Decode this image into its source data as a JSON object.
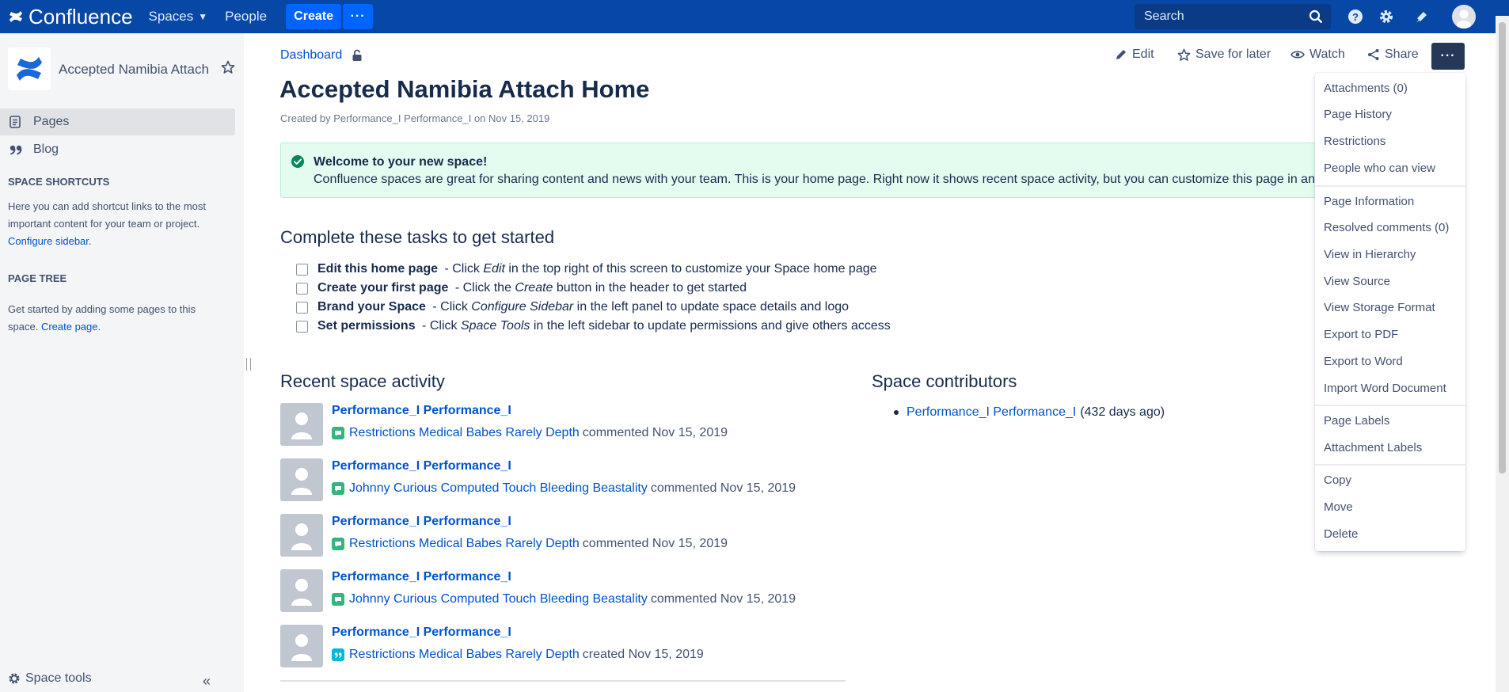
{
  "topbar": {
    "brand": "Confluence",
    "nav": [
      {
        "label": "Spaces"
      },
      {
        "label": "People"
      }
    ],
    "create_label": "Create",
    "search_placeholder": "Search"
  },
  "sidebar": {
    "space_name": "Accepted Namibia Attach",
    "nav": [
      {
        "label": "Pages"
      },
      {
        "label": "Blog"
      }
    ],
    "shortcuts_heading": "SPACE SHORTCUTS",
    "shortcuts_text": "Here you can add shortcut links to the most important content for your team or project.",
    "shortcuts_link": "Configure sidebar",
    "page_tree_heading": "PAGE TREE",
    "page_tree_text": "Get started by adding some pages to this space.",
    "page_tree_link": "Create page",
    "space_tools": "Space tools"
  },
  "breadcrumb": {
    "label": "Dashboard"
  },
  "actions": {
    "edit": "Edit",
    "save_for_later": "Save for later",
    "watch": "Watch",
    "share": "Share"
  },
  "page": {
    "title": "Accepted Namibia Attach Home",
    "byline": "Created by Performance_I Performance_I on Nov 15, 2019"
  },
  "info_panel": {
    "title": "Welcome to your new space!",
    "body": "Confluence spaces are great for sharing content and news with your team. This is your home page. Right now it shows recent space activity, but you can customize this page in any way you like."
  },
  "tasks": {
    "heading": "Complete these tasks to get started",
    "items": [
      {
        "bold": "Edit this home page",
        "pre": " - Click ",
        "em": "Edit",
        "post": " in the top right of this screen to customize your Space home page"
      },
      {
        "bold": "Create your first page",
        "pre": " - Click the ",
        "em": "Create",
        "post": " button in the header to get started"
      },
      {
        "bold": "Brand your Space",
        "pre": " - Click ",
        "em": "Configure Sidebar",
        "post": " in the left panel to update space details and logo"
      },
      {
        "bold": "Set permissions",
        "pre": " - Click ",
        "em": "Space Tools",
        "post": " in the left sidebar to update permissions and give others access"
      }
    ]
  },
  "recent": {
    "heading": "Recent space activity",
    "items": [
      {
        "user": "Performance_I Performance_I",
        "page": "Restrictions Medical Babes Rarely Depth",
        "action": "commented Nov 15, 2019",
        "type": "comment"
      },
      {
        "user": "Performance_I Performance_I",
        "page": "Johnny Curious Computed Touch Bleeding Beastality",
        "action": "commented Nov 15, 2019",
        "type": "comment"
      },
      {
        "user": "Performance_I Performance_I",
        "page": "Restrictions Medical Babes Rarely Depth",
        "action": "commented Nov 15, 2019",
        "type": "comment"
      },
      {
        "user": "Performance_I Performance_I",
        "page": "Johnny Curious Computed Touch Bleeding Beastality",
        "action": "commented Nov 15, 2019",
        "type": "comment"
      },
      {
        "user": "Performance_I Performance_I",
        "page": "Restrictions Medical Babes Rarely Depth",
        "action": "created Nov 15, 2019",
        "type": "blog"
      }
    ]
  },
  "contributors": {
    "heading": "Space contributors",
    "items": [
      {
        "name": "Performance_I Performance_I",
        "meta": "(432 days ago)"
      }
    ]
  },
  "menu": {
    "items": [
      "Attachments (0)",
      "Page History",
      "Restrictions",
      "People who can view",
      "Page Information",
      "Resolved comments (0)",
      "View in Hierarchy",
      "View Source",
      "View Storage Format",
      "Export to PDF",
      "Export to Word",
      "Import Word Document",
      "Page Labels",
      "Attachment Labels",
      "Copy",
      "Move",
      "Delete"
    ]
  },
  "colors": {
    "topbar": "#0747a6",
    "link": "#0052cc",
    "success": "#00875a",
    "comment_icon": "#36b37e",
    "blog_icon": "#00b8d9"
  }
}
